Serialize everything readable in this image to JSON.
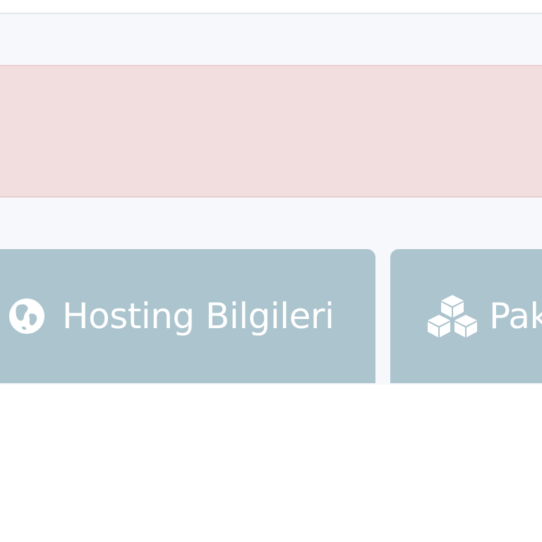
{
  "tabs": [
    {
      "label": "Hosting Bilgileri",
      "icon": "globe-icon"
    },
    {
      "label": "Pak",
      "icon": "cubes-icon"
    }
  ],
  "colors": {
    "alert_background": "#f2dede",
    "tab_background": "#abc4ce",
    "page_background": "#f6f8fb"
  }
}
